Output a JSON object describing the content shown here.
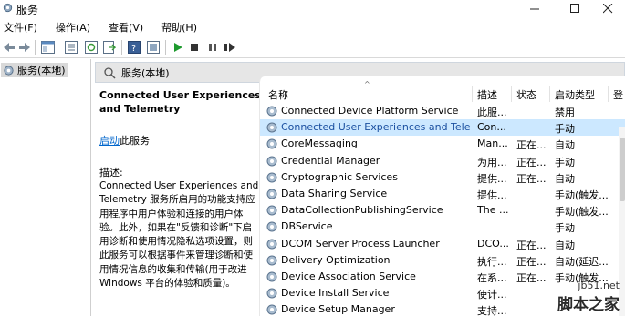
{
  "window": {
    "title": "服务"
  },
  "menu": [
    "文件(F)",
    "操作(A)",
    "查看(V)",
    "帮助(H)"
  ],
  "tree": {
    "root_label": "服务(本地)"
  },
  "panel": {
    "header": "服务(本地)"
  },
  "details": {
    "service_name": "Connected User Experiences and Telemetry",
    "start_link": "启动",
    "start_suffix": "此服务",
    "desc_label": "描述:",
    "desc_text": "Connected User Experiences and Telemetry 服务所启用的功能支持应用程序中用户体验和连接的用户体验。此外，如果在\"反馈和诊断\"下启用诊断和使用情况隐私选项设置，则此服务可以根据事件来管理诊断和使用情况信息的收集和传输(用于改进 Windows 平台的体验和质量)。"
  },
  "columns": {
    "name": "名称",
    "desc": "描述",
    "status": "状态",
    "start_type": "启动类型",
    "extra": "登"
  },
  "rows": [
    {
      "name": "Connected Device Platform Service",
      "desc": "此服...",
      "status": "",
      "start_type": "禁用",
      "extra": ""
    },
    {
      "name": "Connected User Experiences and Telem...",
      "desc": "Con...",
      "status": "",
      "start_type": "手动",
      "extra": ""
    },
    {
      "name": "CoreMessaging",
      "desc": "Man...",
      "status": "正在...",
      "start_type": "自动",
      "extra": ""
    },
    {
      "name": "Credential Manager",
      "desc": "为用...",
      "status": "正在...",
      "start_type": "手动",
      "extra": ""
    },
    {
      "name": "Cryptographic Services",
      "desc": "提供...",
      "status": "正在...",
      "start_type": "自动",
      "extra": ""
    },
    {
      "name": "Data Sharing Service",
      "desc": "提供...",
      "status": "",
      "start_type": "手动(触发...",
      "extra": ""
    },
    {
      "name": "DataCollectionPublishingService",
      "desc": "The ...",
      "status": "",
      "start_type": "手动(触发...",
      "extra": ""
    },
    {
      "name": "DBService",
      "desc": "",
      "status": "",
      "start_type": "手动",
      "extra": ""
    },
    {
      "name": "DCOM Server Process Launcher",
      "desc": "DCO...",
      "status": "正在...",
      "start_type": "自动",
      "extra": ""
    },
    {
      "name": "Delivery Optimization",
      "desc": "执行...",
      "status": "正在...",
      "start_type": "自动(延迟...",
      "extra": ""
    },
    {
      "name": "Device Association Service",
      "desc": "在系...",
      "status": "正在...",
      "start_type": "手动(触发...",
      "extra": ""
    },
    {
      "name": "Device Install Service",
      "desc": "使计...",
      "status": "",
      "start_type": "",
      "extra": ""
    },
    {
      "name": "Device Setup Manager",
      "desc": "支持...",
      "status": "",
      "start_type": "",
      "extra": ""
    }
  ],
  "selected_row": 1,
  "watermark": {
    "url": "jb51.net",
    "brand": "脚本之家"
  }
}
